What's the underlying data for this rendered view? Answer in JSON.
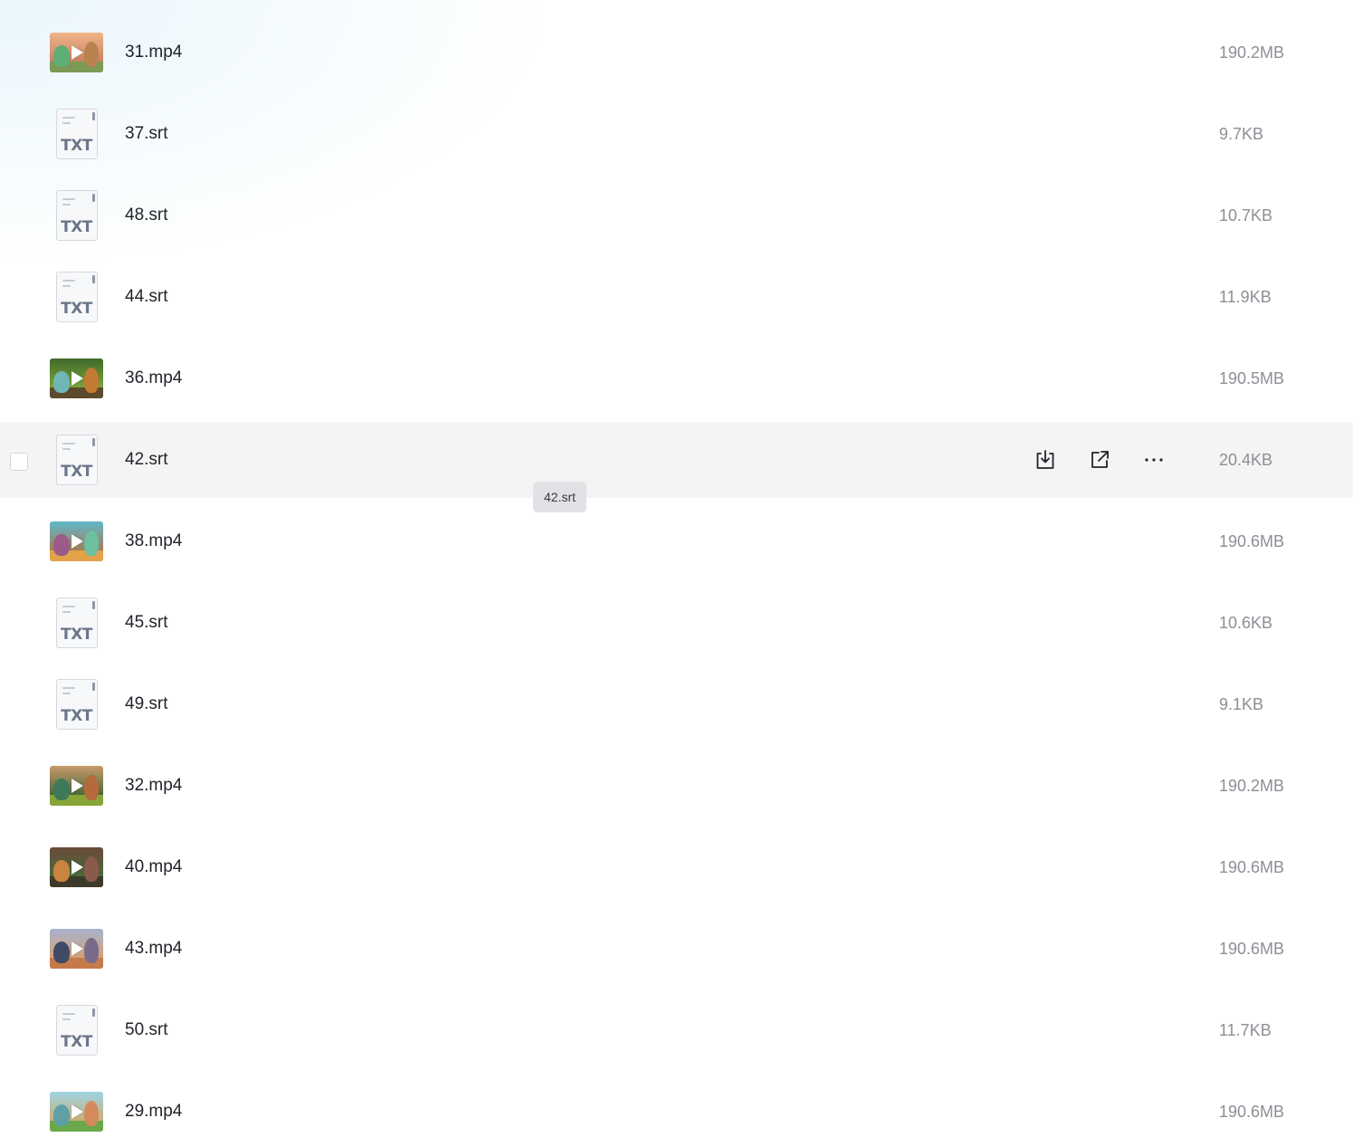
{
  "files": [
    {
      "name": "31.mp4",
      "size": "190.2MB",
      "type": "video",
      "thumb": {
        "sky": "#f1b489",
        "mid": "#c98565",
        "ground": "#7c9a55",
        "blob1": "#5fae77",
        "blob2": "#b8824c"
      }
    },
    {
      "name": "37.srt",
      "size": "9.7KB",
      "type": "txt"
    },
    {
      "name": "48.srt",
      "size": "10.7KB",
      "type": "txt"
    },
    {
      "name": "44.srt",
      "size": "11.9KB",
      "type": "txt"
    },
    {
      "name": "36.mp4",
      "size": "190.5MB",
      "type": "video",
      "thumb": {
        "sky": "#3f6a2a",
        "mid": "#7ba13c",
        "ground": "#5b4a2b",
        "blob1": "#6fb7b4",
        "blob2": "#c37a33"
      }
    },
    {
      "name": "42.srt",
      "size": "20.4KB",
      "type": "txt",
      "hovered": true
    },
    {
      "name": "38.mp4",
      "size": "190.6MB",
      "type": "video",
      "thumb": {
        "sky": "#5fb8c9",
        "mid": "#a1815d",
        "ground": "#e3a24a",
        "blob1": "#9c5a8a",
        "blob2": "#6cc0a0"
      }
    },
    {
      "name": "45.srt",
      "size": "10.6KB",
      "type": "txt"
    },
    {
      "name": "49.srt",
      "size": "9.1KB",
      "type": "txt"
    },
    {
      "name": "32.mp4",
      "size": "190.2MB",
      "type": "video",
      "thumb": {
        "sky": "#c79a6c",
        "mid": "#4f6a3a",
        "ground": "#86a63a",
        "blob1": "#3d7a5a",
        "blob2": "#b46a3a"
      }
    },
    {
      "name": "40.mp4",
      "size": "190.6MB",
      "type": "video",
      "thumb": {
        "sky": "#6b4a3a",
        "mid": "#4a6a3a",
        "ground": "#3e3a2a",
        "blob1": "#c9853f",
        "blob2": "#8a5a4a"
      }
    },
    {
      "name": "43.mp4",
      "size": "190.6MB",
      "type": "video",
      "thumb": {
        "sky": "#a7b3cf",
        "mid": "#d2a27a",
        "ground": "#c57a4a",
        "blob1": "#3e4a66",
        "blob2": "#7a6a8a"
      }
    },
    {
      "name": "50.srt",
      "size": "11.7KB",
      "type": "txt"
    },
    {
      "name": "29.mp4",
      "size": "190.6MB",
      "type": "video",
      "thumb": {
        "sky": "#9fd4e4",
        "mid": "#c8b07a",
        "ground": "#6aa84a",
        "blob1": "#5fa0a5",
        "blob2": "#d48a5a"
      }
    }
  ],
  "txt_label": "TXT",
  "tooltip": "42.srt",
  "row_actions": [
    "download-icon",
    "share-icon",
    "more-icon"
  ],
  "colors": {
    "hover_bg": "#f4f4f4",
    "name_text": "#1f2329",
    "size_text": "#8d8f96",
    "tooltip_bg": "#e3e1e6"
  }
}
